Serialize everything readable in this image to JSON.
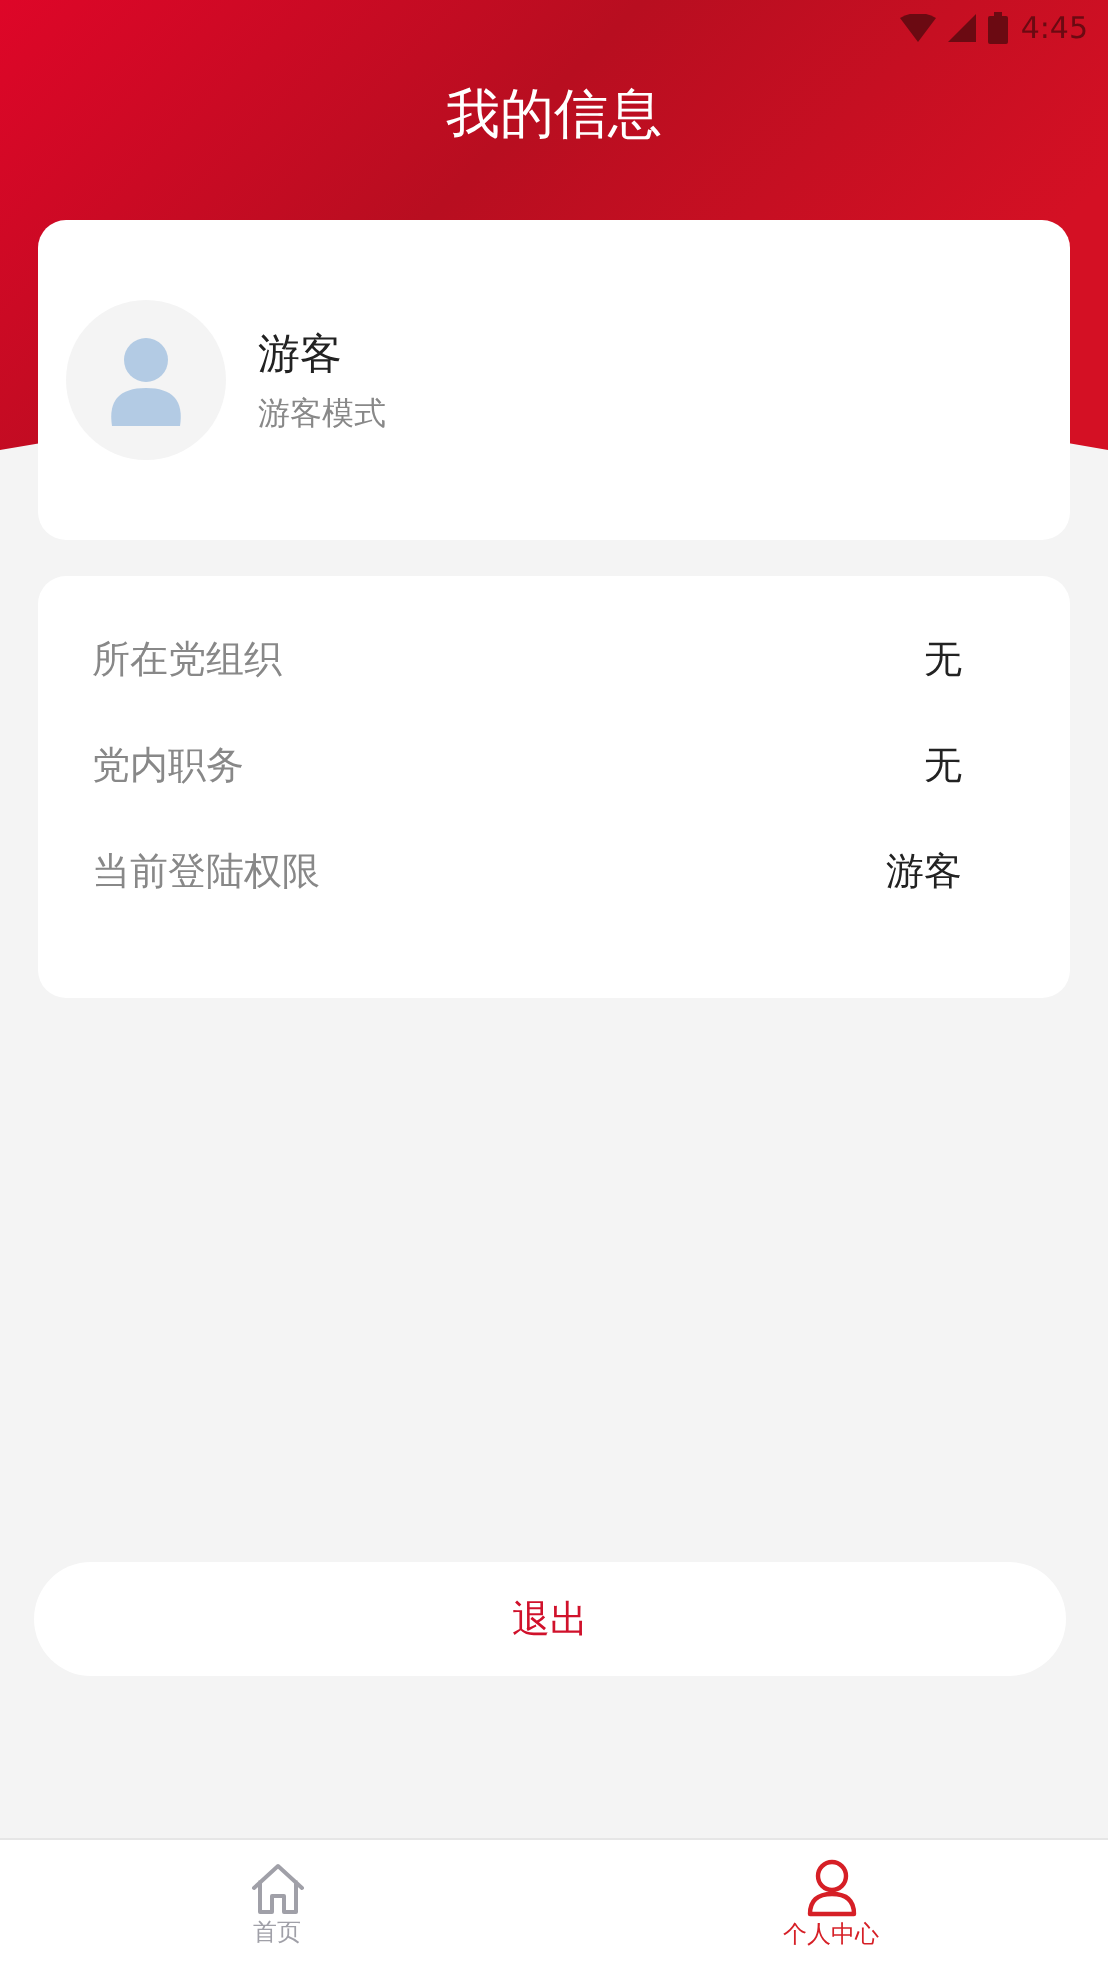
{
  "status_bar": {
    "time": "4:45"
  },
  "title": "我的信息",
  "profile": {
    "name": "游客",
    "subtitle": "游客模式"
  },
  "info_rows": [
    {
      "label": "所在党组织",
      "value": "无"
    },
    {
      "label": "党内职务",
      "value": "无"
    },
    {
      "label": "当前登陆权限",
      "value": "游客"
    }
  ],
  "logout_button": "退出",
  "tabs": [
    {
      "label": "首页",
      "kind": "home",
      "selected": false
    },
    {
      "label": "个人中心",
      "kind": "person",
      "selected": true
    }
  ]
}
